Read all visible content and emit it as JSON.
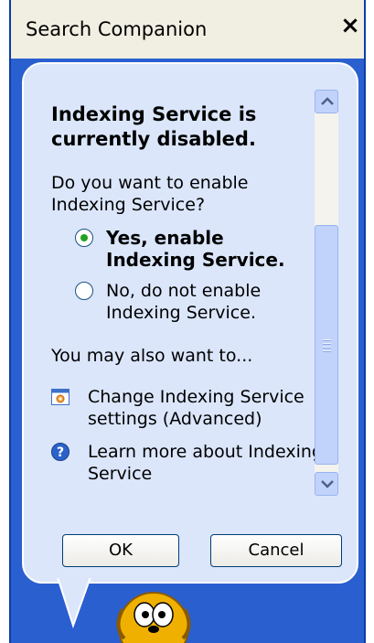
{
  "window": {
    "title": "Search Companion",
    "close_glyph": "×"
  },
  "panel": {
    "heading": "Indexing Service is currently disabled.",
    "question": "Do you want to enable Indexing Service?",
    "options": [
      {
        "label": "Yes, enable Indexing Service.",
        "selected": true
      },
      {
        "label": "No, do not enable Indexing Service.",
        "selected": false
      }
    ],
    "also_label": "You may also want to...",
    "links": [
      {
        "label": "Change Indexing Service settings (Advanced)",
        "icon": "settings-icon"
      },
      {
        "label": "Learn more about Indexing Service",
        "icon": "help-icon"
      }
    ]
  },
  "buttons": {
    "ok_label": "OK",
    "cancel_label": "Cancel"
  },
  "colors": {
    "frame": "#2a5fd0",
    "bubble": "#dbe6fb",
    "radio_selected": "#21a121"
  }
}
